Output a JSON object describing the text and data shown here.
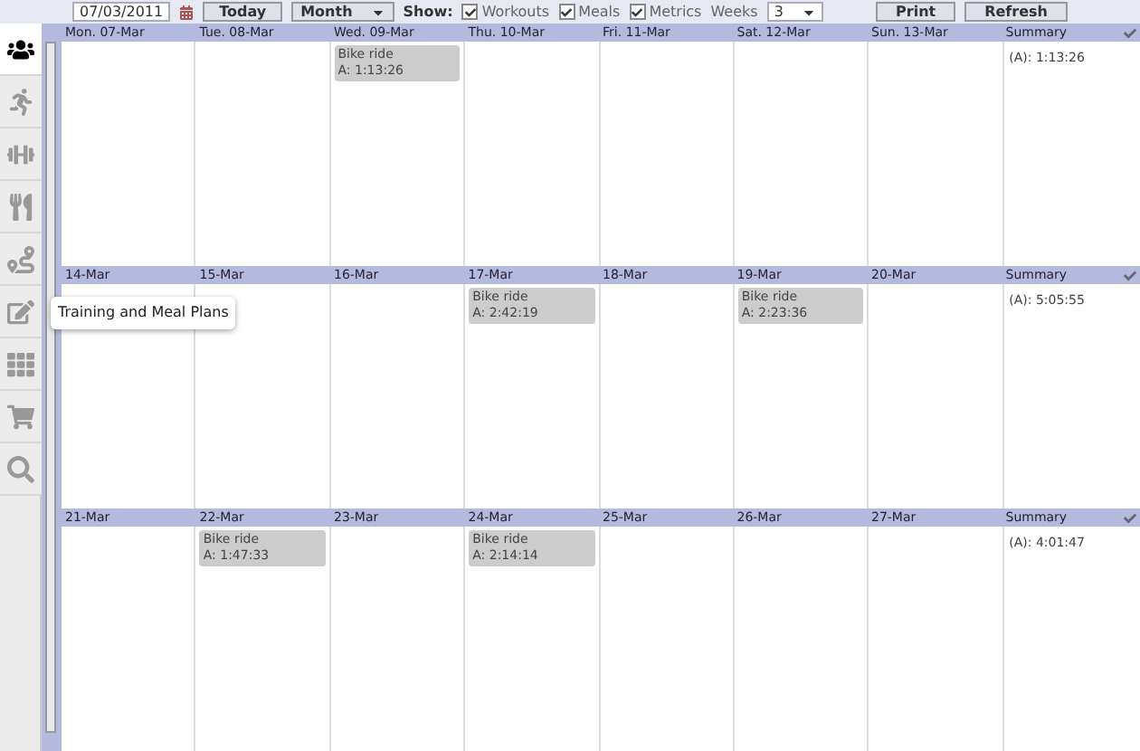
{
  "toolbar": {
    "date": "07/03/2011",
    "today_button": "Today",
    "view_select": "Month",
    "show_label": "Show:",
    "filters": [
      {
        "label": "Workouts",
        "checked": true
      },
      {
        "label": "Meals",
        "checked": true
      },
      {
        "label": "Metrics",
        "checked": true
      }
    ],
    "weeks_label": "Weeks",
    "weeks_value": "3",
    "print_button": "Print",
    "refresh_button": "Refresh"
  },
  "sidebar": {
    "items": [
      {
        "selected": true
      },
      {
        "selected": false
      },
      {
        "selected": false
      },
      {
        "selected": false
      },
      {
        "selected": false
      },
      {
        "selected": false,
        "tooltip": "Training and Meal Plans"
      },
      {
        "selected": false
      },
      {
        "selected": false
      },
      {
        "selected": false
      }
    ]
  },
  "weeks": [
    {
      "days": [
        {
          "label": "Mon. 07-Mar"
        },
        {
          "label": "Tue. 08-Mar"
        },
        {
          "label": "Wed. 09-Mar",
          "entries": [
            {
              "title": "Bike ride",
              "time": "A: 1:13:26"
            }
          ]
        },
        {
          "label": "Thu. 10-Mar"
        },
        {
          "label": "Fri. 11-Mar"
        },
        {
          "label": "Sat. 12-Mar"
        },
        {
          "label": "Sun. 13-Mar"
        }
      ],
      "summary": {
        "label": "Summary",
        "value": "(A): 1:13:26"
      }
    },
    {
      "days": [
        {
          "label": "14-Mar"
        },
        {
          "label": "15-Mar"
        },
        {
          "label": "16-Mar"
        },
        {
          "label": "17-Mar",
          "entries": [
            {
              "title": "Bike ride",
              "time": "A: 2:42:19"
            }
          ]
        },
        {
          "label": "18-Mar"
        },
        {
          "label": "19-Mar",
          "entries": [
            {
              "title": "Bike ride",
              "time": "A: 2:23:36"
            }
          ]
        },
        {
          "label": "20-Mar"
        }
      ],
      "summary": {
        "label": "Summary",
        "value": "(A): 5:05:55"
      }
    },
    {
      "days": [
        {
          "label": "21-Mar"
        },
        {
          "label": "22-Mar",
          "entries": [
            {
              "title": "Bike ride",
              "time": "A: 1:47:33"
            }
          ]
        },
        {
          "label": "23-Mar"
        },
        {
          "label": "24-Mar",
          "entries": [
            {
              "title": "Bike ride",
              "time": "A: 2:14:14"
            }
          ]
        },
        {
          "label": "25-Mar"
        },
        {
          "label": "26-Mar"
        },
        {
          "label": "27-Mar"
        }
      ],
      "summary": {
        "label": "Summary",
        "value": "(A): 4:01:47"
      }
    }
  ]
}
